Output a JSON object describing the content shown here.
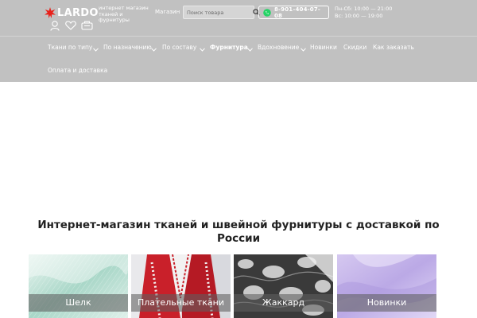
{
  "header": {
    "logo": "LARDO",
    "tagline": "интернет магазин тканей и фурнитуры",
    "shop_link": "Магазин",
    "search_placeholder": "Поиск товара",
    "phone": "8-901-404-07-08",
    "hours_weekdays": "Пн-Сб: 10:00 — 21:00",
    "hours_sunday": "Вс: 10:00 — 19:00"
  },
  "nav": [
    {
      "label": "Ткани по типу",
      "has_dropdown": true,
      "active": false
    },
    {
      "label": "По назначению",
      "has_dropdown": true,
      "active": false
    },
    {
      "label": "По составу",
      "has_dropdown": true,
      "active": false
    },
    {
      "label": "Фурнитура",
      "has_dropdown": true,
      "active": true
    },
    {
      "label": "Вдохновение",
      "has_dropdown": true,
      "active": false
    },
    {
      "label": "Новинки",
      "has_dropdown": false,
      "active": false
    },
    {
      "label": "Скидки",
      "has_dropdown": false,
      "active": false
    },
    {
      "label": "Как заказать",
      "has_dropdown": false,
      "active": false
    },
    {
      "label": "Оплата и доставка",
      "has_dropdown": false,
      "active": false
    }
  ],
  "headline": {
    "line1": "Интернет-магазин тканей и швейной фурнитуры с доставкой по",
    "line2": "России"
  },
  "categories": [
    {
      "label": "Шелк"
    },
    {
      "label": "Плательные ткани"
    },
    {
      "label": "Жаккард"
    },
    {
      "label": "Новинки"
    }
  ],
  "colors": {
    "header_bg": "#c1c1c1",
    "header_text": "#ffffff",
    "logo_accent": "#e8201a",
    "whatsapp": "#25d366",
    "headline_text": "#222222"
  },
  "icons": {
    "user": "user-icon",
    "favorites": "heart-icon",
    "cart": "cart-icon",
    "search": "search-icon",
    "whatsapp": "whatsapp-icon",
    "dropdown": "chevron-down-icon"
  }
}
